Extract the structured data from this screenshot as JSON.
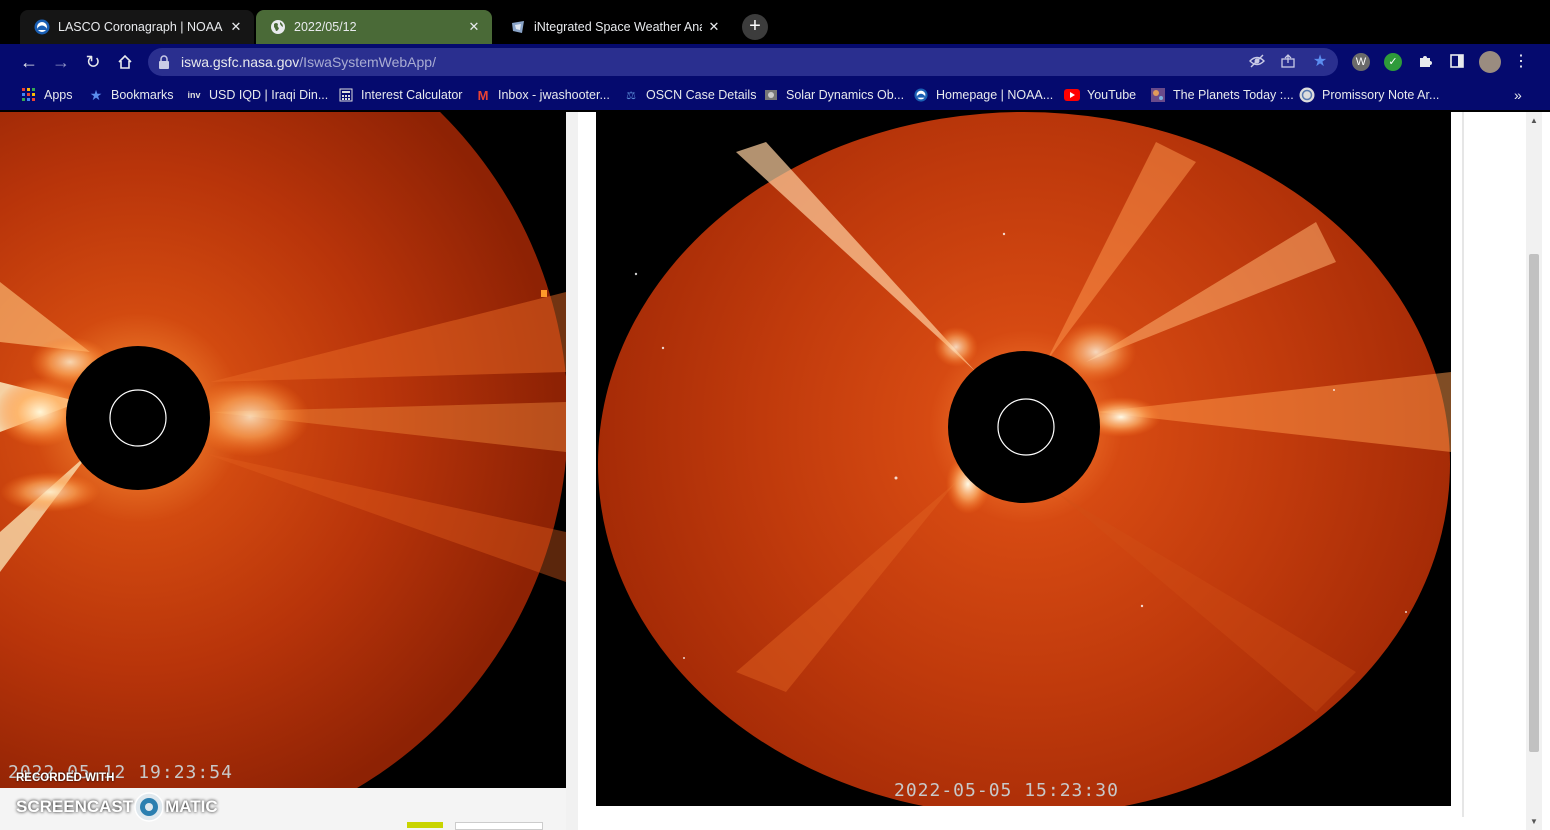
{
  "tabs": [
    {
      "title": "LASCO Coronagraph | NOAA / N",
      "favicon": "noaa-icon",
      "active": false
    },
    {
      "title": "2022/05/12",
      "favicon": "globe-icon",
      "active": true
    },
    {
      "title": "iNtegrated Space Weather Analy",
      "favicon": "iswa-icon",
      "active": false
    }
  ],
  "new_tab": "+",
  "toolbar": {
    "url_host": "iswa.gsfc.nasa.gov",
    "url_path": "/IswaSystemWebApp/"
  },
  "bookmarks": [
    {
      "label": "Apps",
      "icon": "apps-grid-icon"
    },
    {
      "label": "Bookmarks",
      "icon": "star-icon"
    },
    {
      "label": "USD IQD | Iraqi Din...",
      "icon": "investing-icon"
    },
    {
      "label": "Interest Calculator",
      "icon": "calculator-icon"
    },
    {
      "label": "Inbox - jwashooter...",
      "icon": "gmail-icon"
    },
    {
      "label": "OSCN Case Details",
      "icon": "oscn-icon"
    },
    {
      "label": "Solar Dynamics Ob...",
      "icon": "sdo-icon"
    },
    {
      "label": "Homepage | NOAA...",
      "icon": "noaa-icon"
    },
    {
      "label": "YouTube",
      "icon": "youtube-icon"
    },
    {
      "label": "The Planets Today :...",
      "icon": "planets-icon"
    },
    {
      "label": "Promissory Note Ar...",
      "icon": "document-icon"
    }
  ],
  "bookmarks_overflow": "»",
  "images": {
    "left_timestamp": "2022-05-12 19:23:54",
    "right_timestamp": "2022-05-05 15:23:30"
  },
  "watermark": {
    "line1": "RECORDED WITH",
    "brand_left": "SCREENCAST",
    "brand_right": "MATIC"
  },
  "colors": {
    "toolbar": "#050a6e",
    "active_tab": "#4a6a37",
    "corona": "#c43a0a"
  }
}
